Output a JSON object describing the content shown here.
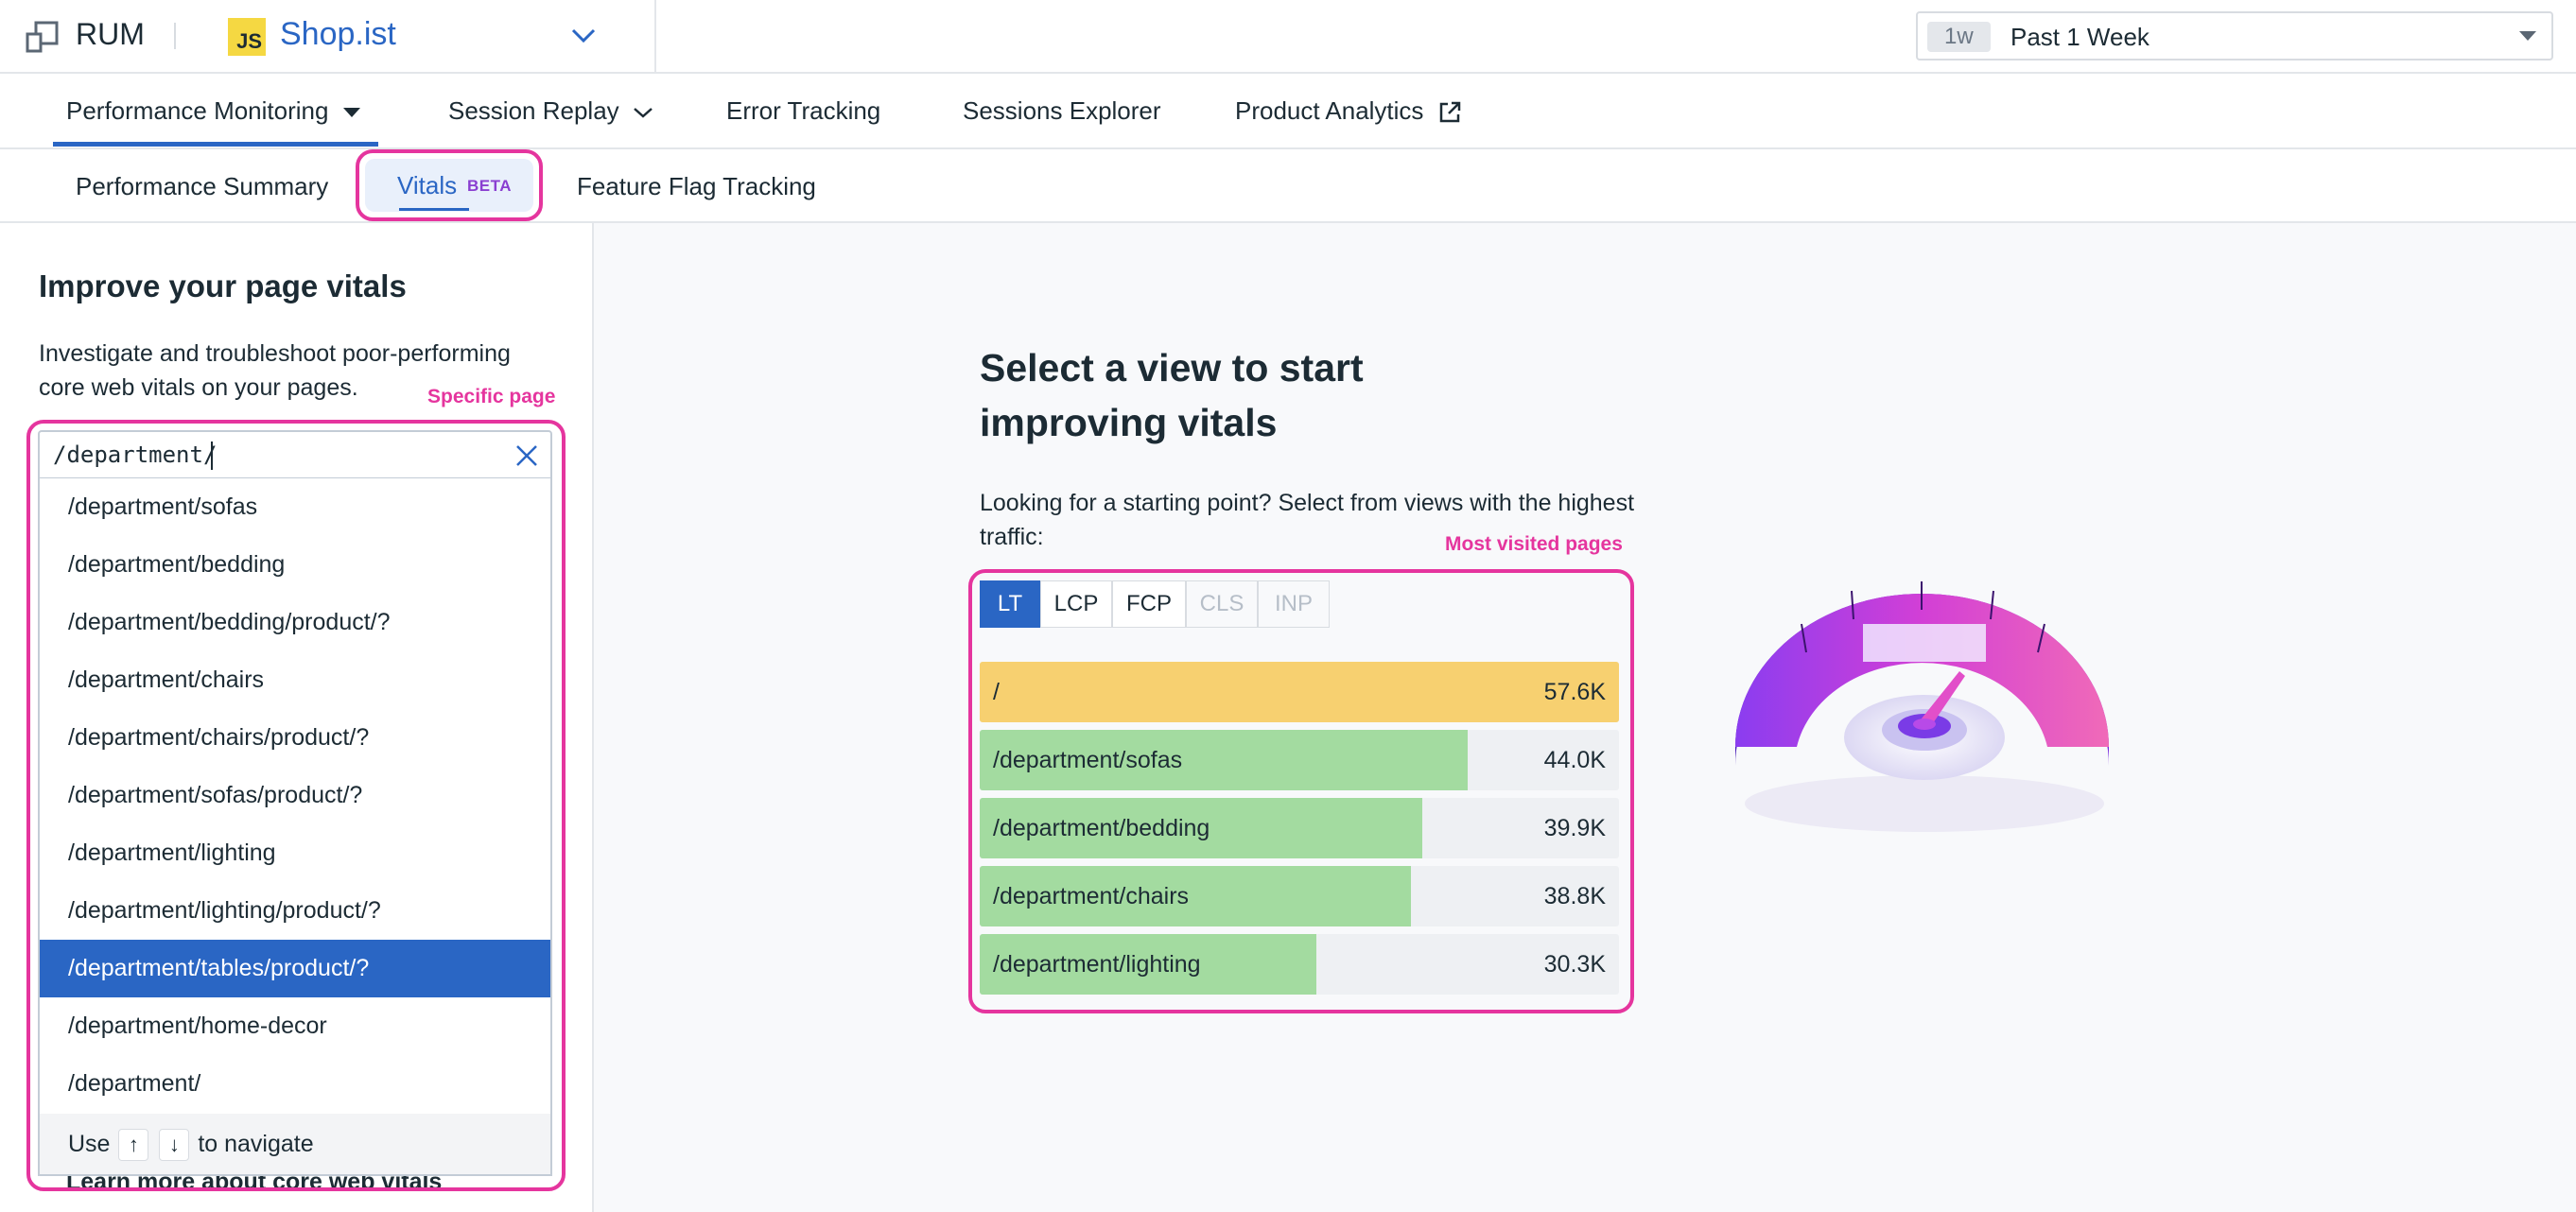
{
  "header": {
    "product": "RUM",
    "app_badge": "JS",
    "app_name": "Shop.ist",
    "time_chip": "1w",
    "time_label": "Past 1 Week"
  },
  "tabs": [
    {
      "label": "Performance Monitoring",
      "active": true
    },
    {
      "label": "Session Replay"
    },
    {
      "label": "Error Tracking"
    },
    {
      "label": "Sessions Explorer"
    },
    {
      "label": "Product Analytics"
    }
  ],
  "subtabs": {
    "summary": "Performance Summary",
    "vitals": "Vitals",
    "beta": "BETA",
    "flags": "Feature Flag Tracking"
  },
  "left": {
    "title": "Improve your page vitals",
    "description": "Investigate and troubleshoot poor-performing core web vitals on your pages.",
    "annotation": "Specific page",
    "search_value": "/department/",
    "items": [
      "/department/sofas",
      "/department/bedding",
      "/department/bedding/product/?",
      "/department/chairs",
      "/department/chairs/product/?",
      "/department/sofas/product/?",
      "/department/lighting",
      "/department/lighting/product/?",
      "/department/tables/product/?",
      "/department/home-decor",
      "/department/"
    ],
    "selected_index": 8,
    "footer_use": "Use",
    "footer_up": "↑",
    "footer_down": "↓",
    "footer_nav": "to navigate",
    "learn_more": "Learn more about core web vitals"
  },
  "main": {
    "title": "Select a view to start improving vitals",
    "description": "Looking for a starting point? Select from views with the highest traffic:",
    "annotation": "Most visited pages",
    "metrics": [
      {
        "label": "LT",
        "state": "active"
      },
      {
        "label": "LCP",
        "state": "normal"
      },
      {
        "label": "FCP",
        "state": "normal"
      },
      {
        "label": "CLS",
        "state": "disabled"
      },
      {
        "label": "INP",
        "state": "disabled"
      }
    ],
    "views": [
      {
        "label": "/",
        "value": "57.6K",
        "fraction": 1.0,
        "color": "#f7d070"
      },
      {
        "label": "/department/sofas",
        "value": "44.0K",
        "fraction": 0.764,
        "color": "#a3dba0"
      },
      {
        "label": "/department/bedding",
        "value": "39.9K",
        "fraction": 0.692,
        "color": "#a3dba0"
      },
      {
        "label": "/department/chairs",
        "value": "38.8K",
        "fraction": 0.674,
        "color": "#a3dba0"
      },
      {
        "label": "/department/lighting",
        "value": "30.3K",
        "fraction": 0.526,
        "color": "#a3dba0"
      }
    ]
  },
  "colors": {
    "accent": "#2a66c4",
    "highlight": "#e5359e",
    "beta": "#8a3fd1"
  }
}
